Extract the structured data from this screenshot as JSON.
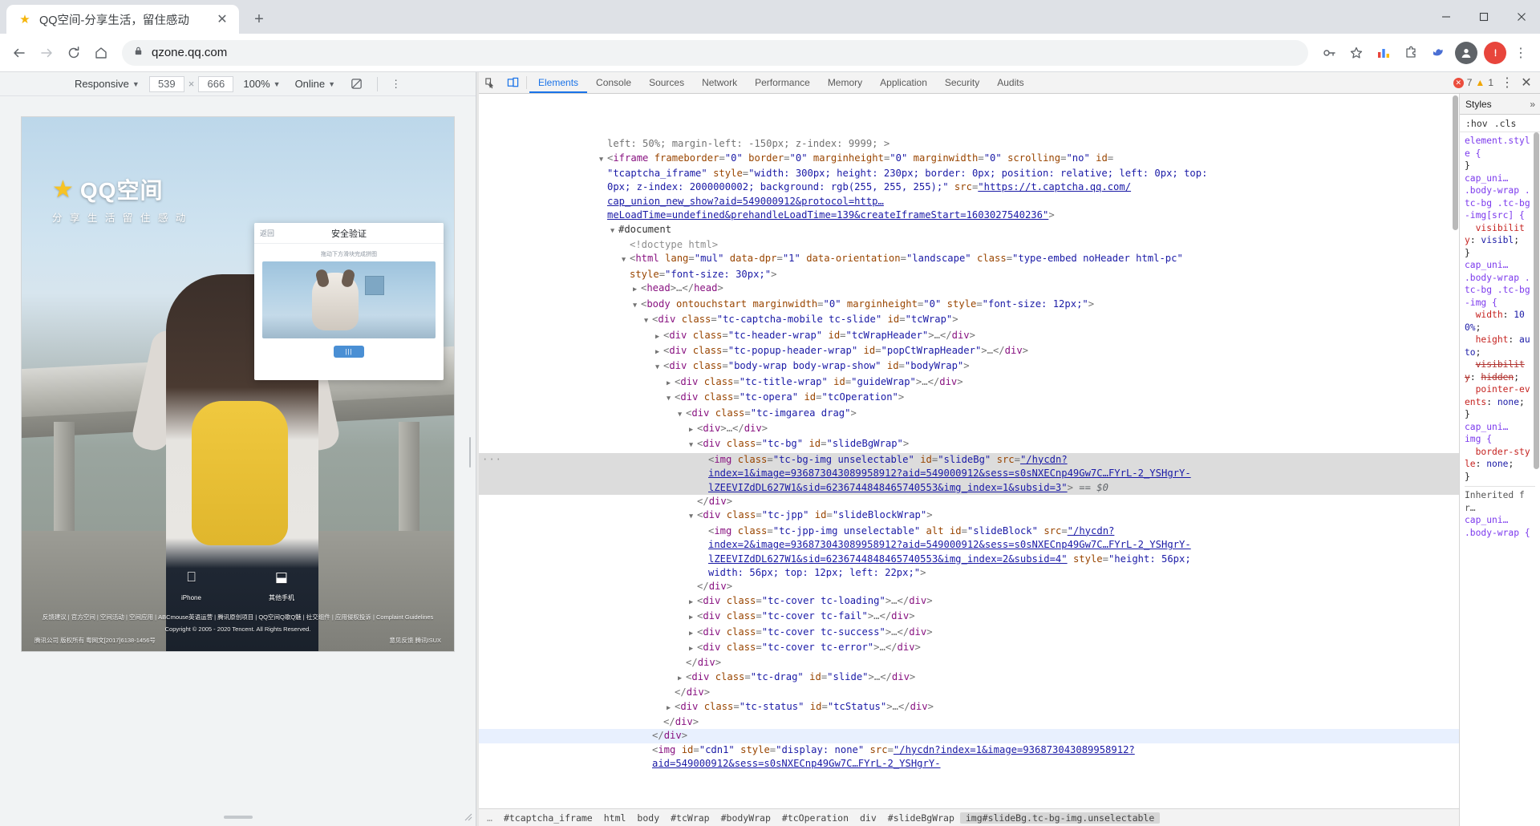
{
  "browser": {
    "tab": {
      "title": "QQ空间-分享生活，留住感动",
      "favicon_icon": "qzone-star-icon",
      "close_icon": "✕"
    },
    "new_tab_icon": "+",
    "window_controls": {
      "minimize": "—",
      "maximize": "❐",
      "close": "✕"
    },
    "toolbar": {
      "back_icon": "←",
      "forward_icon": "→",
      "reload_icon": "⟳",
      "home_icon": "⌂",
      "lock_icon": "🔒",
      "url": "qzone.qq.com",
      "key_icon": "⚷",
      "star_icon": "☆",
      "ext1_icon": "extension-bar-icon",
      "ext2_icon": "extension-puzzle-icon",
      "ext3_icon": "extension-bird-icon",
      "profile_icon": "account-icon",
      "menu_icon": "⋮"
    }
  },
  "device_toolbar": {
    "device": "Responsive",
    "width": "539",
    "height": "666",
    "separator": "×",
    "zoom": "100%",
    "throttle": "Online",
    "rotate_icon": "rotate-device-icon",
    "more_icon": "⋮"
  },
  "page": {
    "logo_star": "★",
    "logo_name": "QQ空间",
    "slogan": "分 享 生 活    留 住 感 动",
    "captcha": {
      "back": "返回",
      "title": "安全验证",
      "tip": "拖动下方滑块完成拼图",
      "slider_label": "|||"
    },
    "downloads": [
      {
        "icon": "",
        "label": "iPhone"
      },
      {
        "icon": "⬓",
        "label": "其他手机"
      }
    ],
    "links": "反馈建议 | 官方空间 | 空间活动 | 空间应用 | ABCmouse英语运营 | 腾讯原创项目 | QQ空间Q歌Q魅 | 社交组件 | 应用侵权投诉 | Complaint Guidelines",
    "copyright": "Copyright © 2005 - 2020 Tencent. All Rights Reserved.",
    "license_left": "腾讯公司 版权所有 粤网文[2017]6138-1456号",
    "license_right": "意见反馈  腾讯ISUX"
  },
  "devtools": {
    "tools": {
      "inspect_icon": "inspect-element-icon",
      "device_icon": "toggle-device-toolbar-icon"
    },
    "tabs": [
      "Elements",
      "Console",
      "Sources",
      "Network",
      "Performance",
      "Memory",
      "Application",
      "Security",
      "Audits"
    ],
    "active_tab": "Elements",
    "errors": "7",
    "warnings": "1",
    "settings_icon": "⋮",
    "close_icon": "✕",
    "dom_lines": [
      {
        "indent": 0,
        "tri": "",
        "html": "<span class=\"punc\">left: 50%; margin-left: -150px; z-index: 9999; &gt;</span>",
        "partial": true
      },
      {
        "indent": 0,
        "tri": "▼",
        "html": "<span class=\"punc\">&lt;</span><span class=\"tag\">iframe</span> <span class=\"attr\">frameborder</span><span class=\"punc\">=</span><span class=\"val\">\"0\"</span> <span class=\"attr\">border</span><span class=\"punc\">=</span><span class=\"val\">\"0\"</span> <span class=\"attr\">marginheight</span><span class=\"punc\">=</span><span class=\"val\">\"0\"</span> <span class=\"attr\">marginwidth</span><span class=\"punc\">=</span><span class=\"val\">\"0\"</span> <span class=\"attr\">scrolling</span><span class=\"punc\">=</span><span class=\"val\">\"no\"</span> <span class=\"attr\">id</span><span class=\"punc\">=</span>"
      },
      {
        "indent": 0,
        "html": "<span class=\"val\">\"tcaptcha_iframe\"</span> <span class=\"attr\">style</span><span class=\"punc\">=</span><span class=\"val\">\"width: 300px; height: 230px; border: 0px; position: relative; left: 0px; top: </span>"
      },
      {
        "indent": 0,
        "html": "<span class=\"val\">0px; z-index: 2000000002; background: rgb(255, 255, 255);\"</span> <span class=\"attr\">src</span><span class=\"punc\">=</span><span class=\"link\">\"https://t.captcha.qq.com/</span>"
      },
      {
        "indent": 0,
        "html": "<span class=\"link\">cap_union_new_show?aid=549000912&amp;protocol=http…</span>"
      },
      {
        "indent": 0,
        "html": "<span class=\"link\">meLoadTime=undefined&amp;prehandleLoadTime=139&amp;createIframeStart=1603027540236\"</span><span class=\"punc\">&gt;</span>"
      },
      {
        "indent": 1,
        "tri": "▼",
        "html": "<span class=\"txt\">#document</span>"
      },
      {
        "indent": 2,
        "html": "<span class=\"comment\">&lt;!doctype html&gt;</span>"
      },
      {
        "indent": 2,
        "tri": "▼",
        "html": "<span class=\"punc\">&lt;</span><span class=\"tag\">html</span> <span class=\"attr\">lang</span><span class=\"punc\">=</span><span class=\"val\">\"mul\"</span> <span class=\"attr\">data-dpr</span><span class=\"punc\">=</span><span class=\"val\">\"1\"</span> <span class=\"attr\">data-orientation</span><span class=\"punc\">=</span><span class=\"val\">\"landscape\"</span> <span class=\"attr\">class</span><span class=\"punc\">=</span><span class=\"val\">\"type-embed noHeader html-pc\"</span>"
      },
      {
        "indent": 2,
        "html": "<span class=\"attr\">style</span><span class=\"punc\">=</span><span class=\"val\">\"font-size: 30px;\"</span><span class=\"punc\">&gt;</span>"
      },
      {
        "indent": 3,
        "tri": "▶",
        "html": "<span class=\"punc\">&lt;</span><span class=\"tag\">head</span><span class=\"punc\">&gt;</span><span class=\"punc\">…</span><span class=\"punc\">&lt;/</span><span class=\"tag\">head</span><span class=\"punc\">&gt;</span>"
      },
      {
        "indent": 3,
        "tri": "▼",
        "html": "<span class=\"punc\">&lt;</span><span class=\"tag\">body</span> <span class=\"attr\">ontouchstart</span> <span class=\"attr\">marginwidth</span><span class=\"punc\">=</span><span class=\"val\">\"0\"</span> <span class=\"attr\">marginheight</span><span class=\"punc\">=</span><span class=\"val\">\"0\"</span> <span class=\"attr\">style</span><span class=\"punc\">=</span><span class=\"val\">\"font-size: 12px;\"</span><span class=\"punc\">&gt;</span>"
      },
      {
        "indent": 4,
        "tri": "▼",
        "html": "<span class=\"punc\">&lt;</span><span class=\"tag\">div</span> <span class=\"attr\">class</span><span class=\"punc\">=</span><span class=\"val\">\"tc-captcha-mobile tc-slide\"</span> <span class=\"attr\">id</span><span class=\"punc\">=</span><span class=\"val\">\"tcWrap\"</span><span class=\"punc\">&gt;</span>"
      },
      {
        "indent": 5,
        "tri": "▶",
        "html": "<span class=\"punc\">&lt;</span><span class=\"tag\">div</span> <span class=\"attr\">class</span><span class=\"punc\">=</span><span class=\"val\">\"tc-header-wrap\"</span> <span class=\"attr\">id</span><span class=\"punc\">=</span><span class=\"val\">\"tcWrapHeader\"</span><span class=\"punc\">&gt;…&lt;/</span><span class=\"tag\">div</span><span class=\"punc\">&gt;</span>"
      },
      {
        "indent": 5,
        "tri": "▶",
        "html": "<span class=\"punc\">&lt;</span><span class=\"tag\">div</span> <span class=\"attr\">class</span><span class=\"punc\">=</span><span class=\"val\">\"tc-popup-header-wrap\"</span> <span class=\"attr\">id</span><span class=\"punc\">=</span><span class=\"val\">\"popCtWrapHeader\"</span><span class=\"punc\">&gt;…&lt;/</span><span class=\"tag\">div</span><span class=\"punc\">&gt;</span>"
      },
      {
        "indent": 5,
        "tri": "▼",
        "html": "<span class=\"punc\">&lt;</span><span class=\"tag\">div</span> <span class=\"attr\">class</span><span class=\"punc\">=</span><span class=\"val\">\"body-wrap body-wrap-show\"</span> <span class=\"attr\">id</span><span class=\"punc\">=</span><span class=\"val\">\"bodyWrap\"</span><span class=\"punc\">&gt;</span>"
      },
      {
        "indent": 6,
        "tri": "▶",
        "html": "<span class=\"punc\">&lt;</span><span class=\"tag\">div</span> <span class=\"attr\">class</span><span class=\"punc\">=</span><span class=\"val\">\"tc-title-wrap\"</span> <span class=\"attr\">id</span><span class=\"punc\">=</span><span class=\"val\">\"guideWrap\"</span><span class=\"punc\">&gt;…&lt;/</span><span class=\"tag\">div</span><span class=\"punc\">&gt;</span>"
      },
      {
        "indent": 6,
        "tri": "▼",
        "html": "<span class=\"punc\">&lt;</span><span class=\"tag\">div</span> <span class=\"attr\">class</span><span class=\"punc\">=</span><span class=\"val\">\"tc-opera\"</span> <span class=\"attr\">id</span><span class=\"punc\">=</span><span class=\"val\">\"tcOperation\"</span><span class=\"punc\">&gt;</span>"
      },
      {
        "indent": 7,
        "tri": "▼",
        "html": "<span class=\"punc\">&lt;</span><span class=\"tag\">div</span> <span class=\"attr\">class</span><span class=\"punc\">=</span><span class=\"val\">\"tc-imgarea drag\"</span><span class=\"punc\">&gt;</span>"
      },
      {
        "indent": 8,
        "tri": "▶",
        "html": "<span class=\"punc\">&lt;</span><span class=\"tag\">div</span><span class=\"punc\">&gt;…&lt;/</span><span class=\"tag\">div</span><span class=\"punc\">&gt;</span>"
      },
      {
        "indent": 8,
        "tri": "▼",
        "html": "<span class=\"punc\">&lt;</span><span class=\"tag\">div</span> <span class=\"attr\">class</span><span class=\"punc\">=</span><span class=\"val\">\"tc-bg\"</span> <span class=\"attr\">id</span><span class=\"punc\">=</span><span class=\"val\">\"slideBgWrap\"</span><span class=\"punc\">&gt;</span>"
      },
      {
        "indent": 9,
        "selected": true,
        "dots": "···",
        "html": "<span class=\"punc\">&lt;</span><span class=\"tag\">img</span> <span class=\"attr\">class</span><span class=\"punc\">=</span><span class=\"val\">\"tc-bg-img unselectable\"</span> <span class=\"attr\">id</span><span class=\"punc\">=</span><span class=\"val\">\"slideBg\"</span> <span class=\"attr\">src</span><span class=\"punc\">=</span><span class=\"link\">\"/hycdn?</span>"
      },
      {
        "indent": 9,
        "selected": true,
        "html": "<span class=\"link\">index=1&amp;image=936873043089958912?aid=549000912&amp;sess=s0sNXECnp49Gw7C…FYrL-2_YSHgrY-</span>"
      },
      {
        "indent": 9,
        "selected": true,
        "html": "<span class=\"link\">lZEEVIZdDL627W1&amp;sid=6236744848465740553&amp;img_index=1&amp;subsid=3\"</span><span class=\"punc\">&gt;</span> <span class=\"eq-val\">== $0</span>"
      },
      {
        "indent": 8,
        "html": "<span class=\"punc\">&lt;/</span><span class=\"tag\">div</span><span class=\"punc\">&gt;</span>"
      },
      {
        "indent": 8,
        "tri": "▼",
        "html": "<span class=\"punc\">&lt;</span><span class=\"tag\">div</span> <span class=\"attr\">class</span><span class=\"punc\">=</span><span class=\"val\">\"tc-jpp\"</span> <span class=\"attr\">id</span><span class=\"punc\">=</span><span class=\"val\">\"slideBlockWrap\"</span><span class=\"punc\">&gt;</span>"
      },
      {
        "indent": 9,
        "html": "<span class=\"punc\">&lt;</span><span class=\"tag\">img</span> <span class=\"attr\">class</span><span class=\"punc\">=</span><span class=\"val\">\"tc-jpp-img unselectable\"</span> <span class=\"attr\">alt</span> <span class=\"attr\">id</span><span class=\"punc\">=</span><span class=\"val\">\"slideBlock\"</span> <span class=\"attr\">src</span><span class=\"punc\">=</span><span class=\"link\">\"/hycdn?</span>"
      },
      {
        "indent": 9,
        "html": "<span class=\"link\">index=2&amp;image=936873043089958912?aid=549000912&amp;sess=s0sNXECnp49Gw7C…FYrL-2_YSHgrY-</span>"
      },
      {
        "indent": 9,
        "html": "<span class=\"link\">lZEEVIZdDL627W1&amp;sid=6236744848465740553&amp;img_index=2&amp;subsid=4\"</span> <span class=\"attr\">style</span><span class=\"punc\">=</span><span class=\"val\">\"height: 56px;</span>"
      },
      {
        "indent": 9,
        "html": "<span class=\"val\">width: 56px; top: 12px; left: 22px;\"</span><span class=\"punc\">&gt;</span>"
      },
      {
        "indent": 8,
        "html": "<span class=\"punc\">&lt;/</span><span class=\"tag\">div</span><span class=\"punc\">&gt;</span>"
      },
      {
        "indent": 8,
        "tri": "▶",
        "html": "<span class=\"punc\">&lt;</span><span class=\"tag\">div</span> <span class=\"attr\">class</span><span class=\"punc\">=</span><span class=\"val\">\"tc-cover tc-loading\"</span><span class=\"punc\">&gt;…&lt;/</span><span class=\"tag\">div</span><span class=\"punc\">&gt;</span>"
      },
      {
        "indent": 8,
        "tri": "▶",
        "html": "<span class=\"punc\">&lt;</span><span class=\"tag\">div</span> <span class=\"attr\">class</span><span class=\"punc\">=</span><span class=\"val\">\"tc-cover tc-fail\"</span><span class=\"punc\">&gt;…&lt;/</span><span class=\"tag\">div</span><span class=\"punc\">&gt;</span>"
      },
      {
        "indent": 8,
        "tri": "▶",
        "html": "<span class=\"punc\">&lt;</span><span class=\"tag\">div</span> <span class=\"attr\">class</span><span class=\"punc\">=</span><span class=\"val\">\"tc-cover tc-success\"</span><span class=\"punc\">&gt;…&lt;/</span><span class=\"tag\">div</span><span class=\"punc\">&gt;</span>"
      },
      {
        "indent": 8,
        "tri": "▶",
        "html": "<span class=\"punc\">&lt;</span><span class=\"tag\">div</span> <span class=\"attr\">class</span><span class=\"punc\">=</span><span class=\"val\">\"tc-cover tc-error\"</span><span class=\"punc\">&gt;…&lt;/</span><span class=\"tag\">div</span><span class=\"punc\">&gt;</span>"
      },
      {
        "indent": 7,
        "html": "<span class=\"punc\">&lt;/</span><span class=\"tag\">div</span><span class=\"punc\">&gt;</span>"
      },
      {
        "indent": 7,
        "tri": "▶",
        "html": "<span class=\"punc\">&lt;</span><span class=\"tag\">div</span> <span class=\"attr\">class</span><span class=\"punc\">=</span><span class=\"val\">\"tc-drag\"</span> <span class=\"attr\">id</span><span class=\"punc\">=</span><span class=\"val\">\"slide\"</span><span class=\"punc\">&gt;…&lt;/</span><span class=\"tag\">div</span><span class=\"punc\">&gt;</span>"
      },
      {
        "indent": 6,
        "html": "<span class=\"punc\">&lt;/</span><span class=\"tag\">div</span><span class=\"punc\">&gt;</span>"
      },
      {
        "indent": 6,
        "tri": "▶",
        "html": "<span class=\"punc\">&lt;</span><span class=\"tag\">div</span> <span class=\"attr\">class</span><span class=\"punc\">=</span><span class=\"val\">\"tc-status\"</span> <span class=\"attr\">id</span><span class=\"punc\">=</span><span class=\"val\">\"tcStatus\"</span><span class=\"punc\">&gt;…&lt;/</span><span class=\"tag\">div</span><span class=\"punc\">&gt;</span>"
      },
      {
        "indent": 5,
        "html": "<span class=\"punc\">&lt;/</span><span class=\"tag\">div</span><span class=\"punc\">&gt;</span>"
      },
      {
        "indent": 4,
        "highlight": true,
        "html": "<span class=\"punc\">&lt;/</span><span class=\"tag\">div</span><span class=\"punc\">&gt;</span>"
      },
      {
        "indent": 4,
        "html": "<span class=\"punc\">&lt;</span><span class=\"tag\">img</span> <span class=\"attr\">id</span><span class=\"punc\">=</span><span class=\"val\">\"cdn1\"</span> <span class=\"attr\">style</span><span class=\"punc\">=</span><span class=\"val\">\"display: none\"</span> <span class=\"attr\">src</span><span class=\"punc\">=</span><span class=\"link\">\"/hycdn?index=1&amp;image=936873043089958912?</span>"
      },
      {
        "indent": 4,
        "html": "<span class=\"link\">aid=549000912&amp;sess=s0sNXECnp49Gw7C…FYrL-2_YSHgrY-</span>"
      }
    ],
    "breadcrumb": [
      "#tcaptcha_iframe",
      "html",
      "body",
      "#tcWrap",
      "#bodyWrap",
      "#tcOperation",
      "div",
      "#slideBgWrap",
      "img#slideBg.tc-bg-img.unselectable"
    ],
    "breadcrumb_active_index": 8,
    "breadcrumb_overflow": "…",
    "styles": {
      "tab": "Styles",
      "more": "»",
      "hov": ":hov",
      "cls": ".cls",
      "rules": [
        {
          "selector": "element.style {",
          "decls": [],
          "close": "}"
        },
        {
          "selector": "cap_uni…",
          "selector2": ".body-wrap .tc-bg .tc-bg-img[src] {",
          "decls": [
            {
              "prop": "visibility",
              "val": "visibl"
            }
          ],
          "close": "}"
        },
        {
          "selector": "cap_uni…",
          "selector2": ".body-wrap .tc-bg .tc-bg-img {",
          "decls": [
            {
              "prop": "width",
              "val": "100%"
            },
            {
              "prop": "height",
              "val": "auto"
            },
            {
              "prop": "visibility",
              "val": "hidden",
              "struck": true
            },
            {
              "prop": "pointer-events",
              "val": "none"
            }
          ],
          "close": "}"
        },
        {
          "selector": "cap_uni…",
          "selector2": "img {",
          "decls": [
            {
              "prop": "border-style",
              "val": "none"
            }
          ],
          "close": "}"
        },
        {
          "selector": "Inherited fr…",
          "inherited": true
        },
        {
          "selector": "cap_uni…",
          "selector2": ".body-wrap {",
          "decls": [],
          "close": ""
        }
      ]
    }
  }
}
